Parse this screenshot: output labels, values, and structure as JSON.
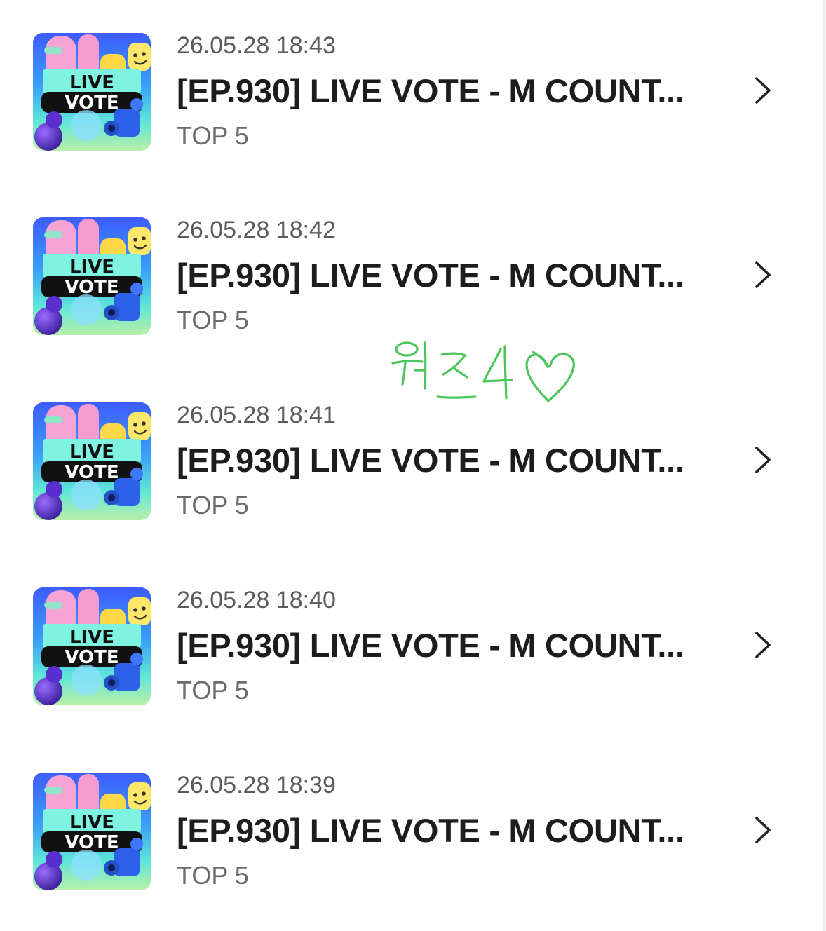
{
  "colors": {
    "background": "#ffffff",
    "title_text": "#1d1d1d",
    "meta_text": "#5b5b5b",
    "handwriting": "#4cc55a"
  },
  "thumbnail": {
    "line1": "LIVE",
    "line2": "VOTE"
  },
  "items": [
    {
      "timestamp": "26.05.28 18:43",
      "title": "[EP.930] LIVE VOTE - M COUNT...",
      "subtitle": "TOP 5"
    },
    {
      "timestamp": "26.05.28 18:42",
      "title": "[EP.930] LIVE VOTE - M COUNT...",
      "subtitle": "TOP 5"
    },
    {
      "timestamp": "26.05.28 18:41",
      "title": "[EP.930] LIVE VOTE - M COUNT...",
      "subtitle": "TOP 5"
    },
    {
      "timestamp": "26.05.28 18:40",
      "title": "[EP.930] LIVE VOTE - M COUNT...",
      "subtitle": "TOP 5"
    },
    {
      "timestamp": "26.05.28 18:39",
      "title": "[EP.930] LIVE VOTE - M COUNT...",
      "subtitle": "TOP 5"
    }
  ],
  "annotation": {
    "text": "위즈4♡",
    "icon": "heart-icon"
  }
}
